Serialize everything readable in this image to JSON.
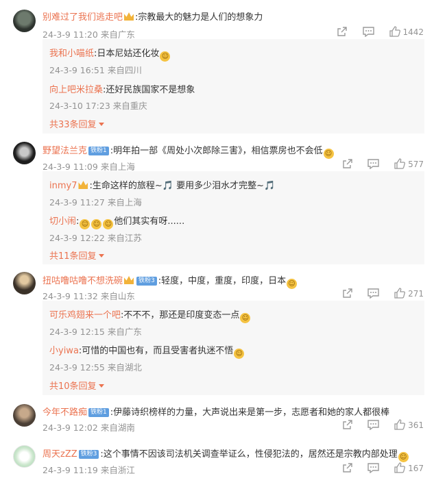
{
  "comments": [
    {
      "name": "别难过了我们逃走吧",
      "text": ":宗教最大的魅力是人们的想象力",
      "time": "24-3-9 11:20",
      "location": "来自广东",
      "likes": "1442",
      "replies": [
        {
          "name": "我和小喵纸",
          "text": ":日本尼姑还化妆",
          "time": "24-3-9 16:51",
          "location": "来自四川"
        },
        {
          "name": "向上吧米拉桑",
          "text": ":还好民族国家不是想象",
          "time": "24-3-10 17:23",
          "location": "来自重庆"
        }
      ],
      "more": "共33条回复"
    },
    {
      "name": "野望法兰克",
      "badge": "铁粉1",
      "text": ":明年拍一部《周处小次郎除三害》，相信票房也不会低",
      "time": "24-3-9 11:09",
      "location": "来自上海",
      "likes": "577",
      "replies": [
        {
          "name": "inmy7",
          "text": ":生命这样的旅程~🎵 要用多少泪水才完整~🎵",
          "time": "24-3-9 11:27",
          "location": "来自上海"
        },
        {
          "name": "切小闹",
          "text": "他们其实有呀......",
          "time": "24-3-9 12:22",
          "location": "来自江苏"
        }
      ],
      "more": "共11条回复"
    },
    {
      "name": "扭咕噜咕噜不想洗碗",
      "badge": "铁粉3",
      "text": ":轻度，中度，重度，印度，日本",
      "time": "24-3-9 11:32",
      "location": "来自山东",
      "likes": "271",
      "replies": [
        {
          "name": "可乐鸡翅来一个吧",
          "text": ":不不不，那还是印度变态一点",
          "time": "24-3-9 12:15",
          "location": "来自广东"
        },
        {
          "name": "小yiwa",
          "text": ":可惜的中国也有，而且受害者执迷不悟",
          "time": "24-3-9 12:55",
          "location": "来自湖北"
        }
      ],
      "more": "共10条回复"
    },
    {
      "name": "今年不路痴",
      "badge": "铁粉1",
      "text": ":伊藤诗织榜样的力量，大声说出来是第一步，志愿者和她的家人都很棒",
      "time": "24-3-9 12:02",
      "location": "来自湖南",
      "likes": "361"
    },
    {
      "name": "周天zZZ",
      "badge": "铁粉3",
      "text": ":这个事情不因该司法机关调查举证么，性侵犯法的，居然还是宗教内部处理",
      "time": "24-3-9 11:19",
      "location": "来自浙江",
      "likes": "167"
    }
  ],
  "icons": {
    "share": "share-icon",
    "comment": "comment-icon",
    "like": "like-icon"
  },
  "colors": {
    "name": "#eb7350",
    "meta": "#939393",
    "badge": "#5f9ee0"
  }
}
